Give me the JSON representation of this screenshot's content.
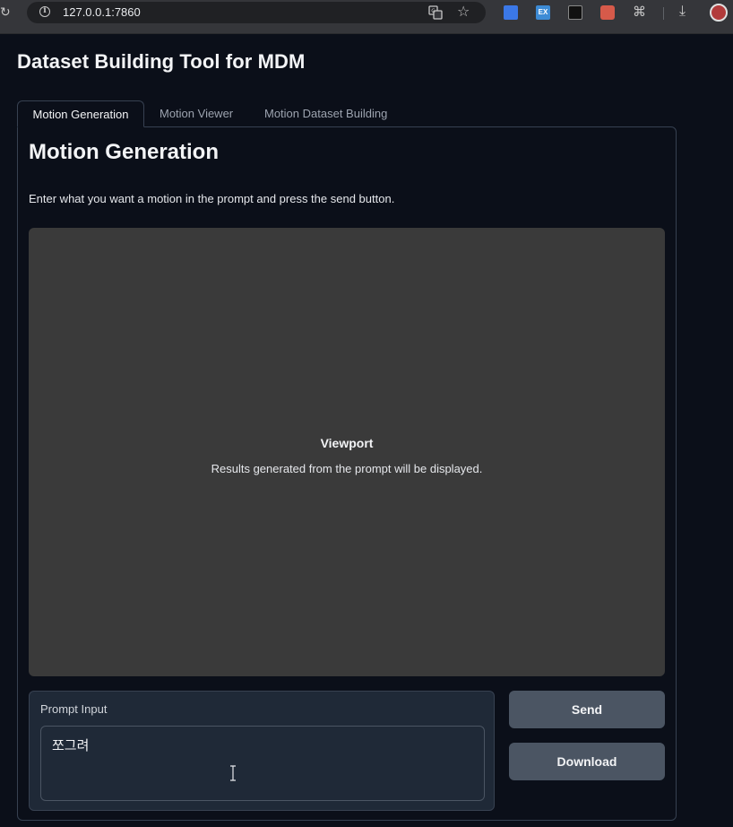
{
  "browser": {
    "url": "127.0.0.1:7860",
    "ext_ex_label": "EX"
  },
  "page": {
    "title": "Dataset Building Tool for MDM"
  },
  "tabs": [
    {
      "label": "Motion Generation",
      "active": true
    },
    {
      "label": "Motion Viewer",
      "active": false
    },
    {
      "label": "Motion Dataset Building",
      "active": false
    }
  ],
  "panel": {
    "heading": "Motion Generation",
    "description": "Enter what you want a motion in the prompt and press the send button.",
    "viewport": {
      "title": "Viewport",
      "subtitle": "Results generated from the prompt will be displayed."
    },
    "prompt": {
      "label": "Prompt Input",
      "value": "쪼그려"
    },
    "buttons": {
      "send": "Send",
      "download": "Download"
    }
  },
  "icons": {
    "reload": "reload-icon",
    "info": "info-icon",
    "translate": "translate-icon",
    "star": "star-icon",
    "extensions": "puzzle-icon",
    "download": "download-icon",
    "profile": "avatar"
  }
}
